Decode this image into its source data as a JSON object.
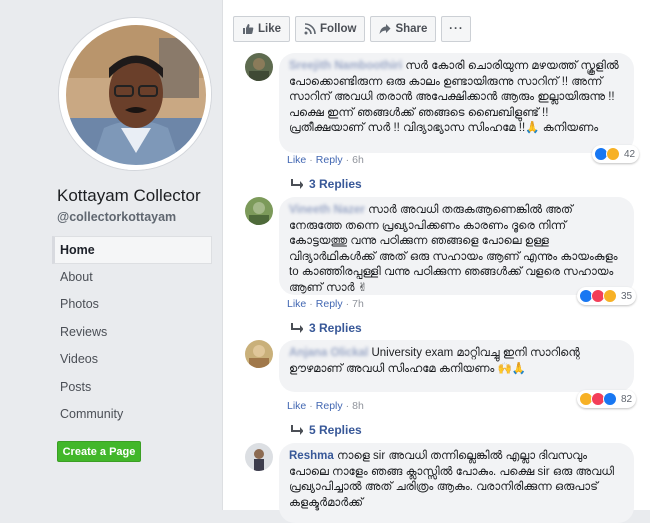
{
  "page": {
    "name": "Kottayam Collector",
    "handle": "@collectorkottayam"
  },
  "nav": {
    "items": [
      "Home",
      "About",
      "Photos",
      "Reviews",
      "Videos",
      "Posts",
      "Community"
    ],
    "active": "Home"
  },
  "create_page_label": "Create a Page",
  "actions": {
    "like": "Like",
    "follow": "Follow",
    "share": "Share",
    "more": "···"
  },
  "comments": [
    {
      "name": "Sreejith Namboothiri",
      "name_blurred": true,
      "text": "സർ കോരി ചൊരിയുന്ന മഴയത്ത് സ്കൂളിൽ പോക്കൊണ്ടിരുന്ന ഒരു കാലം ഉണ്ടായിരുന്നു സാറിന് !! അന്ന് സാറിന് അവധി തരാൻ അപേക്ഷിക്കാൻ ആരും ഇല്ലായിരുന്നു !! പക്ഷെ ഇന്ന് ഞങ്ങൾക്ക് ഞങ്ങടെ ബൈബിളുണ്ട് !! പ്രതീക്ഷയാണ് സർ !! വിദ്യാഭ്യാസ സിംഹമേ !!🙏 കനിയണം",
      "like": "Like",
      "reply": "Reply",
      "time": "6h",
      "reaction_count": "42",
      "reactions": [
        "like-reaction",
        "haha-reaction"
      ],
      "replies_label": "3 Replies"
    },
    {
      "name": "Vineeth Nazer",
      "name_blurred": true,
      "text": "സാർ അവധി തരുകആണെങ്കിൽ അത് നേരുത്തേ തന്നെ പ്രഖ്യാപിക്കണം കാരണം ദൂരെ നിന്ന് കോട്ടയത്തു വന്നു പഠിക്കുന്ന ഞങ്ങളെ പോലെ ഉള്ള വിദ്യാർഥികൾക്ക് അത് ഒരു സഹായം ആണ് എന്നും കായംകുളം to കാഞ്ഞിരപ്പള്ളി വന്നു പഠിക്കുന്ന ഞങ്ങൾക്ക് വളരെ സഹായം ആണ് സാർ ✌",
      "like": "Like",
      "reply": "Reply",
      "time": "7h",
      "reaction_count": "35",
      "reactions": [
        "like-reaction",
        "love-reaction",
        "haha-reaction"
      ],
      "replies_label": "3 Replies"
    },
    {
      "name": "Anjana Olickal",
      "name_blurred": true,
      "text": "University exam മാറ്റിവച്ചു ഇനി സാറിന്റെ ഊഴമാണ് അവധി സിംഹമേ കനിയണം 🙌🙏",
      "like": "Like",
      "reply": "Reply",
      "time": "8h",
      "reaction_count": "82",
      "reactions": [
        "haha-reaction",
        "love-reaction",
        "like-reaction"
      ],
      "replies_label": "5 Replies"
    },
    {
      "name": "Reshma",
      "name_blurred": false,
      "text": "നാളെ sir അവധി തന്നില്ലെങ്കിൽ എല്ലാ ദിവസവും പോലെ നാളേം ഞങ്ങ ക്ലാസ്സിൽ പോകും. പക്ഷെ sir ഒരു അവധി പ്രഖ്യാപിച്ചാൽ അത് ചരിത്രം ആകും. വരാനിരിക്കുന്ന ഒരുപാട് കളക്ടർമാർക്ക്",
      "like": "",
      "reply": "",
      "time": "",
      "reaction_count": "",
      "reactions": [],
      "replies_label": ""
    }
  ],
  "colors": {
    "link": "#385898",
    "create_button": "#42b72a",
    "like_reaction": "#1877f2",
    "love_reaction": "#f33e58",
    "haha_reaction": "#f7b125"
  }
}
